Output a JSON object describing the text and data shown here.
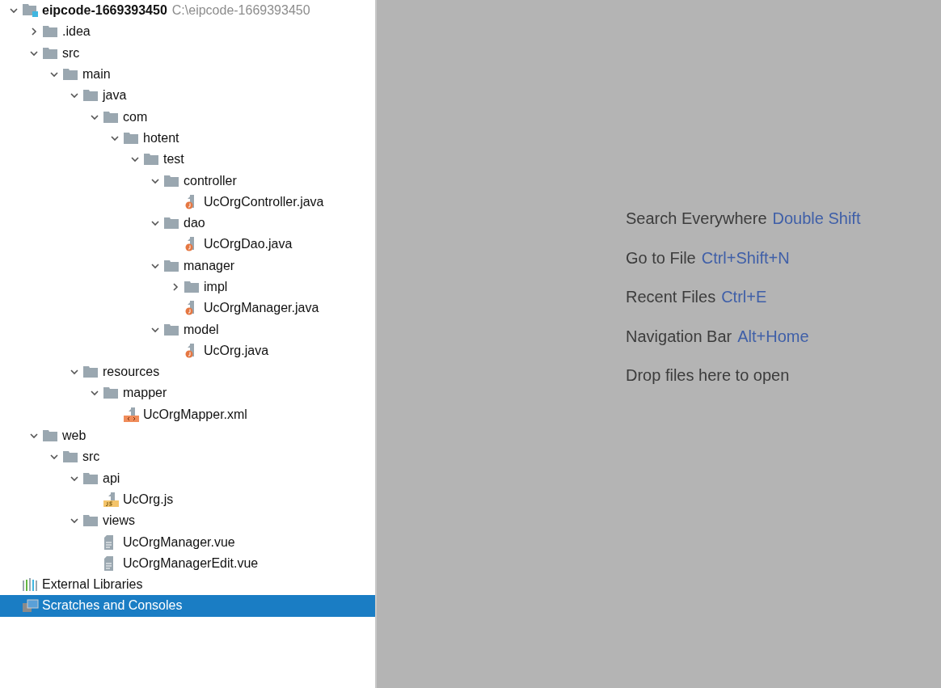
{
  "tree": [
    {
      "kind": "project",
      "label": "eipcode-1669393450",
      "path": "C:\\eipcode-1669393450",
      "expanded": true,
      "selected": false,
      "children": [
        {
          "kind": "folder",
          "label": ".idea",
          "expanded": false,
          "selected": false
        },
        {
          "kind": "folder",
          "label": "src",
          "expanded": true,
          "selected": false,
          "children": [
            {
              "kind": "folder",
              "label": "main",
              "expanded": true,
              "selected": false,
              "children": [
                {
                  "kind": "folder",
                  "label": "java",
                  "expanded": true,
                  "selected": false,
                  "children": [
                    {
                      "kind": "folder",
                      "label": "com",
                      "expanded": true,
                      "selected": false,
                      "children": [
                        {
                          "kind": "folder",
                          "label": "hotent",
                          "expanded": true,
                          "selected": false,
                          "children": [
                            {
                              "kind": "folder",
                              "label": "test",
                              "expanded": true,
                              "selected": false,
                              "children": [
                                {
                                  "kind": "folder",
                                  "label": "controller",
                                  "expanded": true,
                                  "selected": false,
                                  "children": [
                                    {
                                      "kind": "java",
                                      "label": "UcOrgController.java",
                                      "selected": false
                                    }
                                  ]
                                },
                                {
                                  "kind": "folder",
                                  "label": "dao",
                                  "expanded": true,
                                  "selected": false,
                                  "children": [
                                    {
                                      "kind": "java",
                                      "label": "UcOrgDao.java",
                                      "selected": false
                                    }
                                  ]
                                },
                                {
                                  "kind": "folder",
                                  "label": "manager",
                                  "expanded": true,
                                  "selected": false,
                                  "children": [
                                    {
                                      "kind": "folder",
                                      "label": "impl",
                                      "expanded": false,
                                      "selected": false
                                    },
                                    {
                                      "kind": "java",
                                      "label": "UcOrgManager.java",
                                      "selected": false
                                    }
                                  ]
                                },
                                {
                                  "kind": "folder",
                                  "label": "model",
                                  "expanded": true,
                                  "selected": false,
                                  "children": [
                                    {
                                      "kind": "java",
                                      "label": "UcOrg.java",
                                      "selected": false
                                    }
                                  ]
                                }
                              ]
                            }
                          ]
                        }
                      ]
                    }
                  ]
                },
                {
                  "kind": "folder",
                  "label": "resources",
                  "expanded": true,
                  "selected": false,
                  "children": [
                    {
                      "kind": "folder",
                      "label": "mapper",
                      "expanded": true,
                      "selected": false,
                      "children": [
                        {
                          "kind": "xml",
                          "label": "UcOrgMapper.xml",
                          "selected": false
                        }
                      ]
                    }
                  ]
                }
              ]
            }
          ]
        },
        {
          "kind": "folder",
          "label": "web",
          "expanded": true,
          "selected": false,
          "children": [
            {
              "kind": "folder",
              "label": "src",
              "expanded": true,
              "selected": false,
              "children": [
                {
                  "kind": "folder",
                  "label": "api",
                  "expanded": true,
                  "selected": false,
                  "children": [
                    {
                      "kind": "js",
                      "label": "UcOrg.js",
                      "selected": false
                    }
                  ]
                },
                {
                  "kind": "folder",
                  "label": "views",
                  "expanded": true,
                  "selected": false,
                  "children": [
                    {
                      "kind": "vue",
                      "label": "UcOrgManager.vue",
                      "selected": false
                    },
                    {
                      "kind": "vue",
                      "label": "UcOrgManagerEdit.vue",
                      "selected": false
                    }
                  ]
                }
              ]
            }
          ]
        }
      ]
    },
    {
      "kind": "libraries",
      "label": "External Libraries",
      "selected": false
    },
    {
      "kind": "scratches",
      "label": "Scratches and Consoles",
      "selected": true
    }
  ],
  "hints": [
    {
      "label": "Search Everywhere",
      "shortcut": "Double Shift"
    },
    {
      "label": "Go to File",
      "shortcut": "Ctrl+Shift+N"
    },
    {
      "label": "Recent Files",
      "shortcut": "Ctrl+E"
    },
    {
      "label": "Navigation Bar",
      "shortcut": "Alt+Home"
    },
    {
      "label": "Drop files here to open"
    }
  ]
}
